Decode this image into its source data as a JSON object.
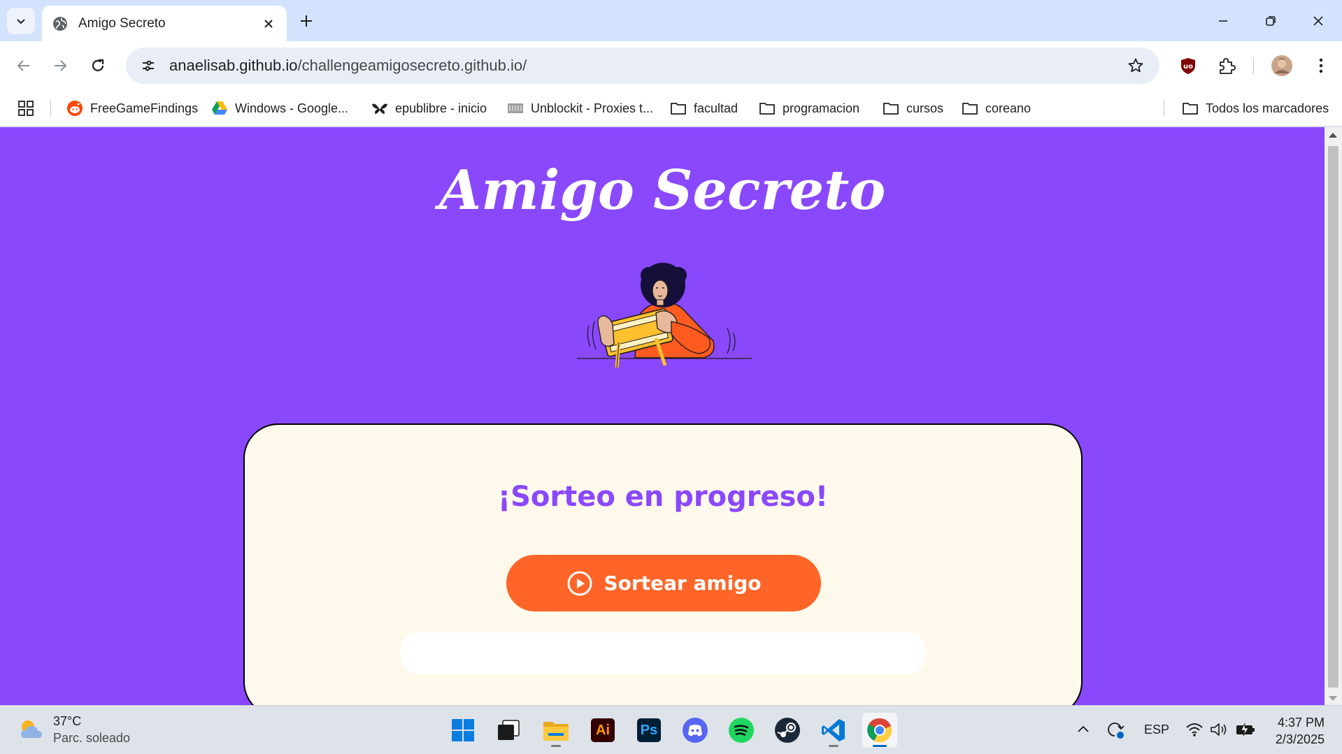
{
  "browser": {
    "tab": {
      "title": "Amigo Secreto"
    },
    "url": {
      "host": "anaelisab.github.io",
      "path": "/challengeamigosecreto.github.io/"
    },
    "bookmarks": [
      {
        "label": "FreeGameFindings",
        "icon": "reddit-icon"
      },
      {
        "label": "Windows - Google...",
        "icon": "google-drive-icon"
      },
      {
        "label": "epublibre - inicio",
        "icon": "epublibre-icon"
      },
      {
        "label": "Unblockit - Proxies t...",
        "icon": "unblockit-icon"
      },
      {
        "label": "facultad",
        "icon": "folder-icon"
      },
      {
        "label": "programacion",
        "icon": "folder-icon"
      },
      {
        "label": "cursos",
        "icon": "folder-icon"
      },
      {
        "label": "coreano",
        "icon": "folder-icon"
      }
    ],
    "all_bookmarks": "Todos los marcadores"
  },
  "page": {
    "title": "Amigo Secreto",
    "heading": "¡Sorteo en progreso!",
    "draw_button": "Sortear amigo",
    "colors": {
      "background": "#8a48fd",
      "card": "#fff9eb",
      "button": "#ff6528",
      "heading": "#8a48fd"
    }
  },
  "taskbar": {
    "weather": {
      "temp": "37°C",
      "condition": "Parc. soleado"
    },
    "apps": [
      "windows-start-icon",
      "task-view-icon",
      "file-explorer-icon",
      "illustrator-icon",
      "photoshop-icon",
      "discord-icon",
      "spotify-icon",
      "steam-icon",
      "vscode-icon",
      "chrome-icon"
    ],
    "illustrator_label": "Ai",
    "photoshop_label": "Ps",
    "language": "ESP",
    "time": "4:37 PM",
    "date": "2/3/2025"
  }
}
